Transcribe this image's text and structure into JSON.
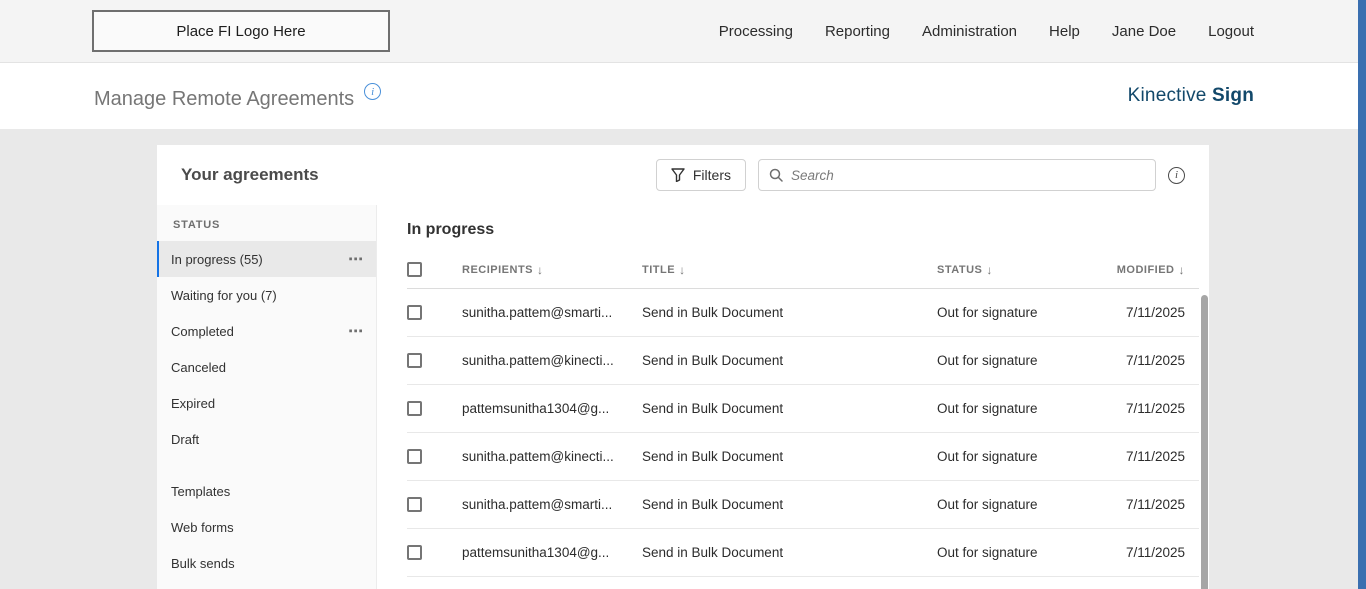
{
  "top_nav": {
    "logo_text": "Place FI Logo Here",
    "items": [
      "Processing",
      "Reporting",
      "Administration",
      "Help",
      "Jane Doe",
      "Logout"
    ]
  },
  "page_header": {
    "title": "Manage Remote Agreements",
    "brand_name": "Kinective",
    "brand_bold": "Sign"
  },
  "agreements": {
    "title": "Your agreements",
    "filters_label": "Filters",
    "search_placeholder": "Search",
    "sidebar": {
      "section_label": "STATUS",
      "status_items": [
        {
          "label": "In progress (55)",
          "selected": true
        },
        {
          "label": "Waiting for you (7)",
          "selected": false
        },
        {
          "label": "Completed",
          "selected": false
        },
        {
          "label": "Canceled",
          "selected": false
        },
        {
          "label": "Expired",
          "selected": false
        },
        {
          "label": "Draft",
          "selected": false
        }
      ],
      "library_items": [
        {
          "label": "Templates"
        },
        {
          "label": "Web forms"
        },
        {
          "label": "Bulk sends"
        }
      ]
    },
    "list": {
      "section_title": "In progress",
      "columns": {
        "recipients": "RECIPIENTS",
        "title": "TITLE",
        "status": "STATUS",
        "modified": "MODIFIED"
      },
      "rows": [
        {
          "recipients": "sunitha.pattem@smarti...",
          "title": "Send in Bulk Document",
          "status": "Out for signature",
          "modified": "7/11/2025"
        },
        {
          "recipients": "sunitha.pattem@kinecti...",
          "title": "Send in Bulk Document",
          "status": "Out for signature",
          "modified": "7/11/2025"
        },
        {
          "recipients": "pattemsunitha1304@g...",
          "title": "Send in Bulk Document",
          "status": "Out for signature",
          "modified": "7/11/2025"
        },
        {
          "recipients": "sunitha.pattem@kinecti...",
          "title": "Send in Bulk Document",
          "status": "Out for signature",
          "modified": "7/11/2025"
        },
        {
          "recipients": "sunitha.pattem@smarti...",
          "title": "Send in Bulk Document",
          "status": "Out for signature",
          "modified": "7/11/2025"
        },
        {
          "recipients": "pattemsunitha1304@g...",
          "title": "Send in Bulk Document",
          "status": "Out for signature",
          "modified": "7/11/2025"
        }
      ]
    }
  },
  "icons": {
    "sort_arrow": "↓",
    "more_options": "⋯",
    "info": "i"
  },
  "colors": {
    "accent_blue": "#1473e6",
    "brand_navy": "#12486a",
    "info_blue": "#4a90d9",
    "edge_strip_blue": "#3a6fb0"
  }
}
